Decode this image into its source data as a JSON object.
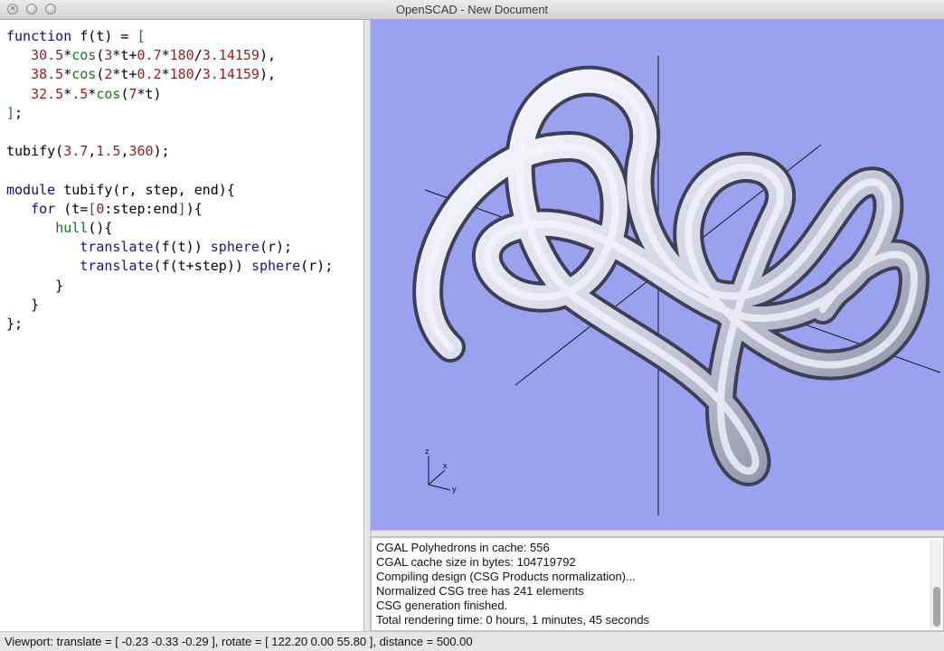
{
  "window": {
    "title": "OpenSCAD - New Document"
  },
  "editor": {
    "lines": [
      "function f(t) = [",
      "   30.5*cos(3*t+0.7*180/3.14159),",
      "   38.5*cos(2*t+0.2*180/3.14159),",
      "   32.5*.5*cos(7*t)",
      "];",
      "",
      "tubify(3.7,1.5,360);",
      "",
      "module tubify(r, step, end){",
      "   for (t=[0:step:end]){",
      "      hull(){",
      "         translate(f(t)) sphere(r);",
      "         translate(f(t+step)) sphere(r);",
      "      }",
      "   }",
      "};"
    ]
  },
  "viewport": {
    "background_color": "#9aa1ee",
    "axes_labels": {
      "x": "x",
      "y": "y",
      "z": "z"
    }
  },
  "console": {
    "lines": [
      "CGAL Polyhedrons in cache: 556",
      "CGAL cache size in bytes: 104719792",
      "Compiling design (CSG Products normalization)...",
      "Normalized CSG tree has 241 elements",
      "CSG generation finished.",
      "Total rendering time: 0 hours, 1 minutes, 45 seconds"
    ]
  },
  "status": {
    "text": "Viewport: translate = [ -0.23 -0.33 -0.29 ], rotate = [ 122.20 0.00 55.80 ], distance = 500.00"
  }
}
